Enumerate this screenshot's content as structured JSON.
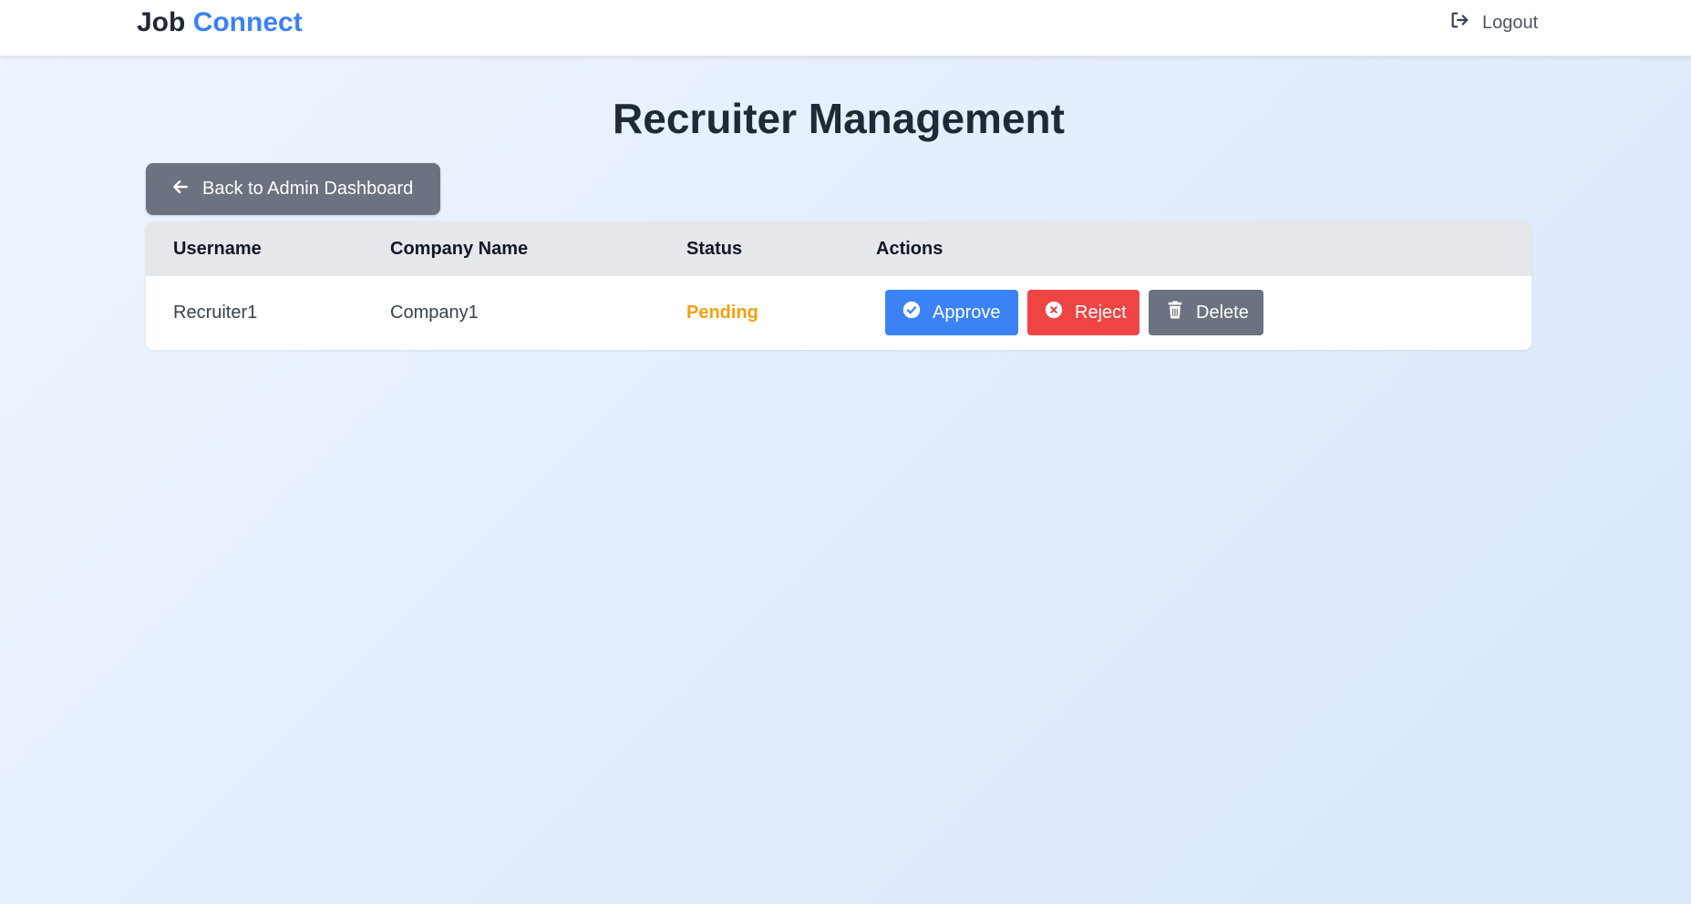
{
  "navbar": {
    "brand_part1": "Job",
    "brand_part2": "Connect",
    "logout_label": "Logout",
    "logout_icon": "sign-out-icon"
  },
  "page": {
    "title": "Recruiter Management",
    "back_button_label": "Back to Admin Dashboard",
    "back_icon": "arrow-left-icon"
  },
  "table": {
    "headers": [
      "Username",
      "Company Name",
      "Status",
      "Actions"
    ],
    "rows": [
      {
        "username": "Recruiter1",
        "company_name": "Company1",
        "status": "Pending",
        "actions": {
          "approve_label": "Approve",
          "reject_label": "Reject",
          "delete_label": "Delete"
        }
      }
    ]
  },
  "colors": {
    "accent": "#3b82f6",
    "danger": "#ef4444",
    "neutral": "#6b7280",
    "pending": "#f59e0b"
  }
}
